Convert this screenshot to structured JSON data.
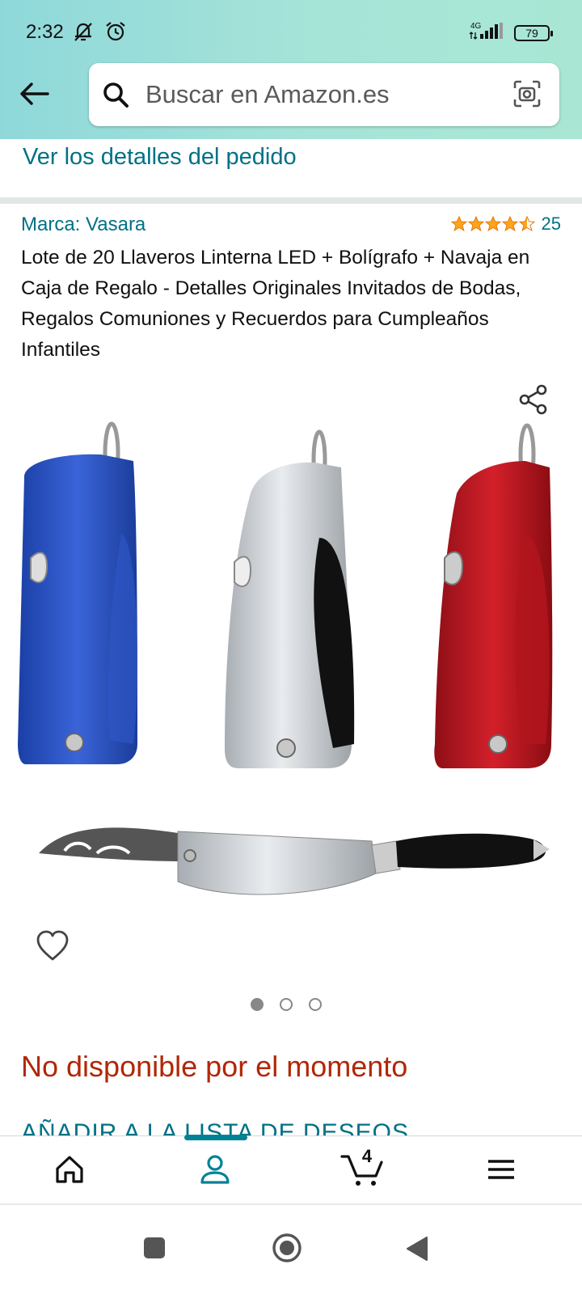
{
  "status_bar": {
    "time": "2:32",
    "network": "4G",
    "battery": "79"
  },
  "search": {
    "placeholder": "Buscar en Amazon.es"
  },
  "order": {
    "details_link": "Ver los detalles del pedido"
  },
  "product": {
    "brand": "Marca: Vasara",
    "rating": 4.5,
    "rating_count": "25",
    "title": "Lote de 20 Llaveros Linterna LED + Bolígrafo + Navaja en Caja de Regalo - Detalles Originales Invitados de Bodas, Regalos Comuniones y Recuerdos para Cumpleaños Infantiles",
    "image_count": 3,
    "active_image": 1,
    "availability": "No disponible por el momento",
    "wishlist_link": "AÑADIR A LA LISTA DE DESEOS"
  },
  "bottom_nav": {
    "items": [
      {
        "name": "home",
        "icon": "home-icon"
      },
      {
        "name": "account",
        "icon": "user-icon",
        "active": true
      },
      {
        "name": "cart",
        "icon": "cart-icon",
        "count": "4"
      },
      {
        "name": "menu",
        "icon": "menu-icon"
      }
    ]
  },
  "colors": {
    "link": "#007185",
    "price_alert": "#B12704",
    "star": "#FFA41C",
    "nav_active": "#008296"
  }
}
